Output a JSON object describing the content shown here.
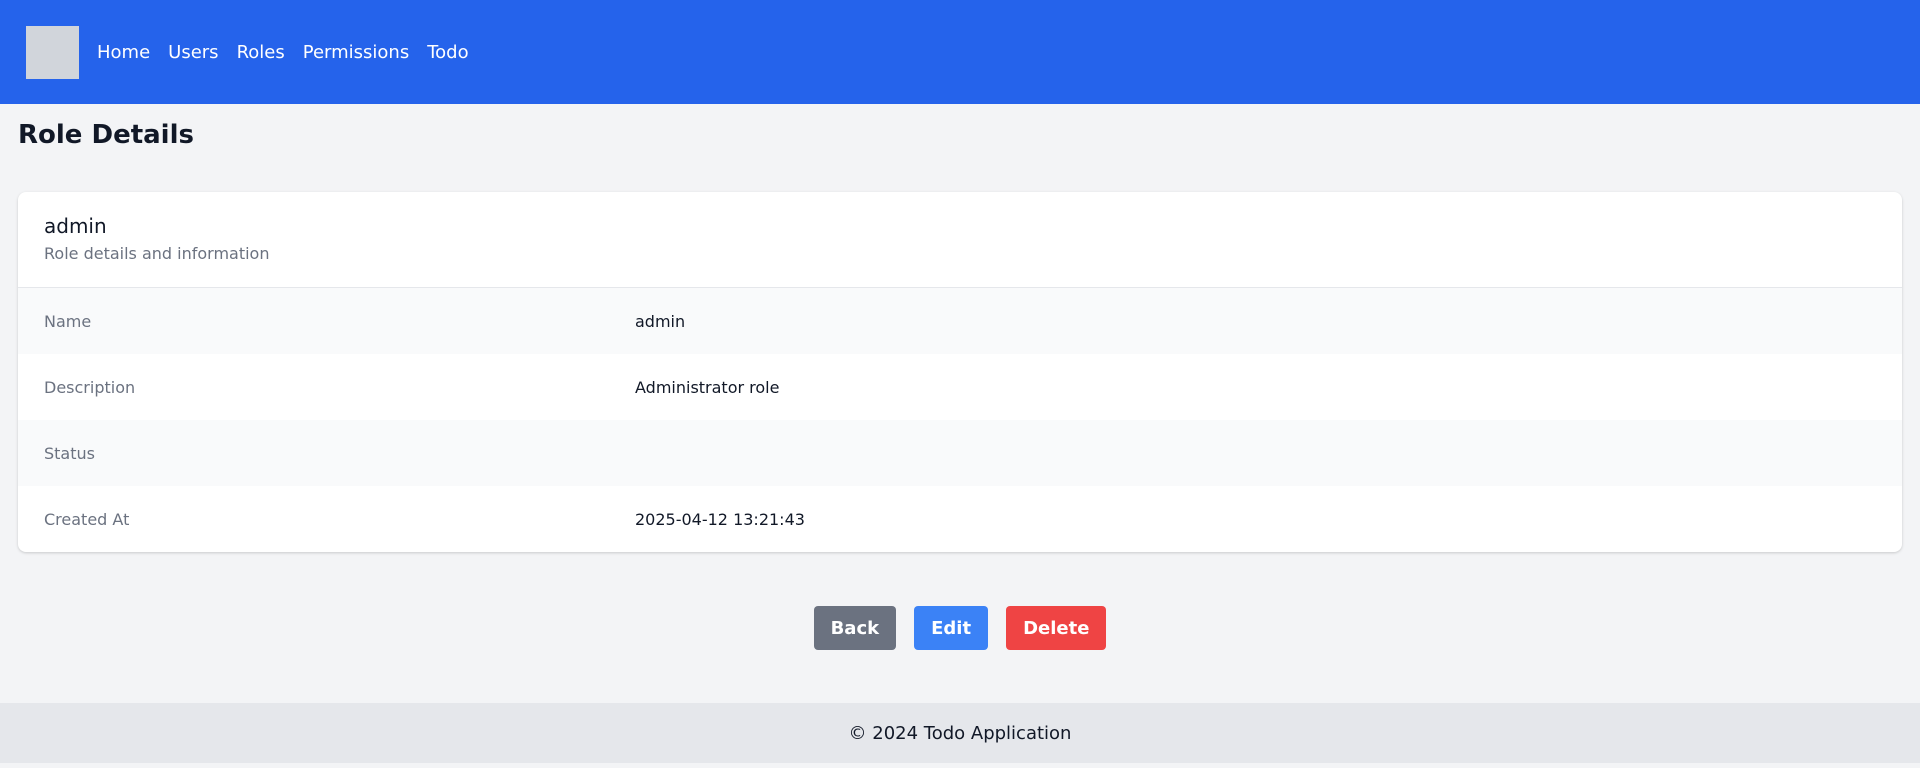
{
  "nav": {
    "links": [
      "Home",
      "Users",
      "Roles",
      "Permissions",
      "Todo"
    ]
  },
  "page": {
    "title": "Role Details"
  },
  "card": {
    "title": "admin",
    "subtitle": "Role details and information",
    "rows": [
      {
        "label": "Name",
        "value": "admin"
      },
      {
        "label": "Description",
        "value": "Administrator role"
      },
      {
        "label": "Status",
        "value": ""
      },
      {
        "label": "Created At",
        "value": "2025-04-12 13:21:43"
      }
    ]
  },
  "actions": {
    "back": "Back",
    "edit": "Edit",
    "delete": "Delete"
  },
  "footer": {
    "text": "© 2024 Todo Application"
  },
  "colors": {
    "navbar": "#2563eb",
    "back_button": "#6b7280",
    "edit_button": "#3b82f6",
    "delete_button": "#ef4444"
  }
}
